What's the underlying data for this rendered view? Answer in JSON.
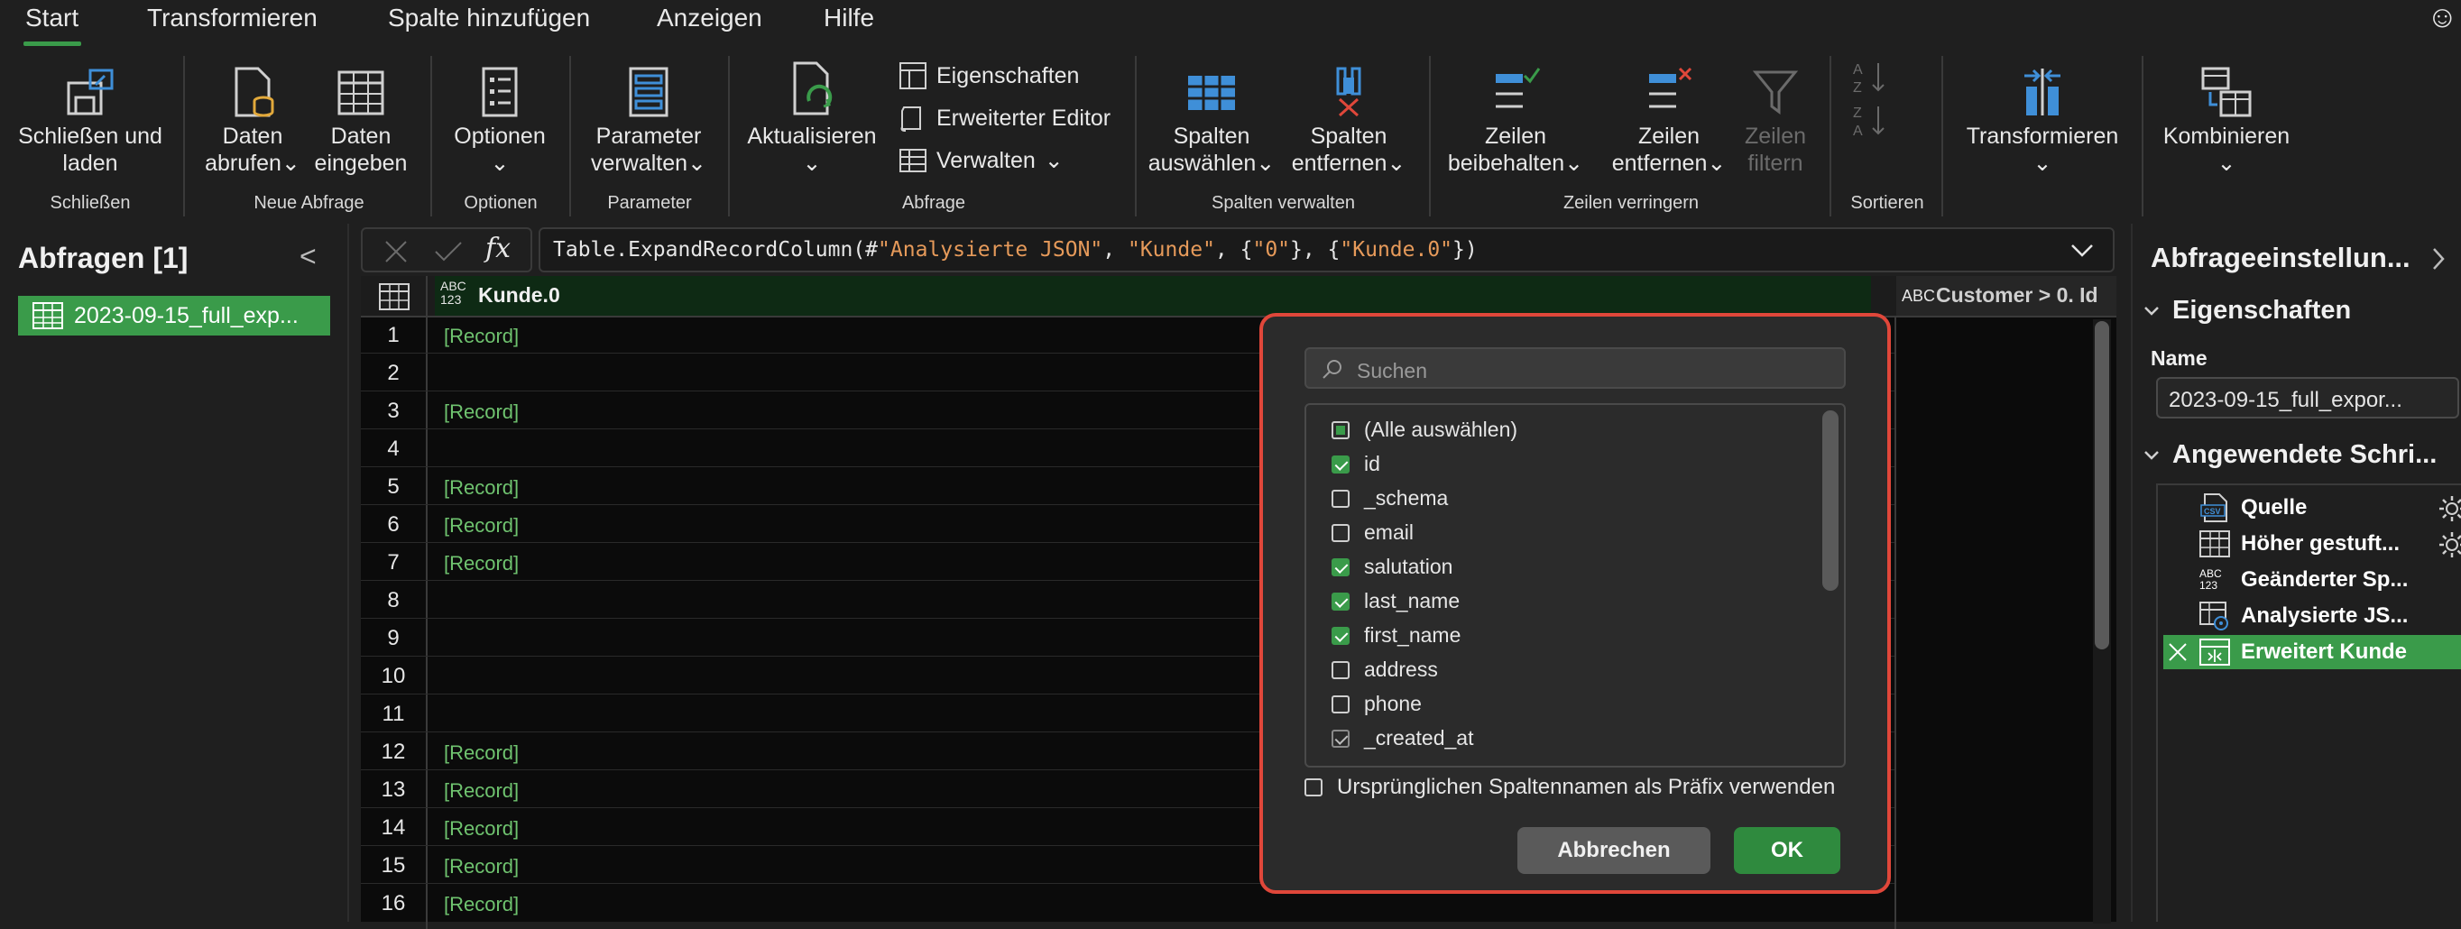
{
  "menu": {
    "tabs": [
      {
        "label": "Start"
      },
      {
        "label": "Transformieren"
      },
      {
        "label": "Spalte hinzufügen"
      },
      {
        "label": "Anzeigen"
      },
      {
        "label": "Hilfe"
      }
    ],
    "smiley": "☺"
  },
  "ribbon": {
    "close_load": {
      "line1": "Schließen und",
      "line2": "laden"
    },
    "get_data": {
      "line1": "Daten",
      "line2": "abrufen"
    },
    "enter_data": {
      "line1": "Daten",
      "line2": "eingeben"
    },
    "options": {
      "line1": "Optionen"
    },
    "manage_params": {
      "line1": "Parameter",
      "line2": "verwalten"
    },
    "refresh": {
      "line1": "Aktualisieren"
    },
    "properties": "Eigenschaften",
    "advanced_editor": "Erweiterter Editor",
    "manage": "Verwalten",
    "choose_columns": {
      "line1": "Spalten",
      "line2": "auswählen"
    },
    "remove_columns": {
      "line1": "Spalten",
      "line2": "entfernen"
    },
    "keep_rows": {
      "line1": "Zeilen",
      "line2": "beibehalten"
    },
    "remove_rows": {
      "line1": "Zeilen",
      "line2": "entfernen"
    },
    "filter_rows": {
      "line1": "Zeilen",
      "line2": "filtern"
    },
    "transform": {
      "line1": "Transformieren"
    },
    "combine": {
      "line1": "Kombinieren"
    },
    "groups": {
      "close": "Schließen",
      "new_query": "Neue Abfrage",
      "options": "Optionen",
      "parameters": "Parameter",
      "query": "Abfrage",
      "manage_columns": "Spalten verwalten",
      "reduce_rows": "Zeilen verringern",
      "sort": "Sortieren"
    },
    "chevron": "⌄"
  },
  "left_panel": {
    "title": "Abfragen [1]",
    "collapse": "<",
    "query_item": "2023-09-15_full_exp..."
  },
  "formula_bar": {
    "fx": "fx",
    "formula_parts": {
      "p1": "Table.ExpandRecordColumn(#",
      "s1": "\"Analysierte JSON\"",
      "p2": ", ",
      "s2": "\"Kunde\"",
      "p3": ", {",
      "s3": "\"0\"",
      "p4": "}, {",
      "s4": "\"Kunde.0\"",
      "p5": "})"
    }
  },
  "grid": {
    "type_badge_top": "ABC",
    "type_badge_bottom": "123",
    "column_header": "Kunde.0",
    "second_header_badge": "ABC",
    "second_column_header": "Customer > 0. Id",
    "rows": [
      {
        "num": "1",
        "value": "[Record]"
      },
      {
        "num": "2",
        "value": ""
      },
      {
        "num": "3",
        "value": "[Record]"
      },
      {
        "num": "4",
        "value": ""
      },
      {
        "num": "5",
        "value": "[Record]"
      },
      {
        "num": "6",
        "value": "[Record]"
      },
      {
        "num": "7",
        "value": "[Record]"
      },
      {
        "num": "8",
        "value": ""
      },
      {
        "num": "9",
        "value": ""
      },
      {
        "num": "10",
        "value": ""
      },
      {
        "num": "11",
        "value": ""
      },
      {
        "num": "12",
        "value": "[Record]"
      },
      {
        "num": "13",
        "value": "[Record]"
      },
      {
        "num": "14",
        "value": "[Record]"
      },
      {
        "num": "15",
        "value": "[Record]"
      },
      {
        "num": "16",
        "value": "[Record]"
      }
    ]
  },
  "dialog": {
    "search_placeholder": "Suchen",
    "options": [
      {
        "label": "(Alle auswählen)",
        "state": "partial"
      },
      {
        "label": "id",
        "state": "checked"
      },
      {
        "label": "_schema",
        "state": "unchecked"
      },
      {
        "label": "email",
        "state": "unchecked"
      },
      {
        "label": "salutation",
        "state": "checked"
      },
      {
        "label": "last_name",
        "state": "checked"
      },
      {
        "label": "first_name",
        "state": "checked"
      },
      {
        "label": "address",
        "state": "unchecked"
      },
      {
        "label": "phone",
        "state": "unchecked"
      },
      {
        "label": "_created_at",
        "state": "gray"
      }
    ],
    "prefix_label": "Ursprünglichen Spaltennamen als Präfix verwenden",
    "cancel": "Abbrechen",
    "ok": "OK"
  },
  "right_panel": {
    "title": "Abfrageeinstellun...",
    "properties_header": "Eigenschaften",
    "name_label": "Name",
    "name_value": "2023-09-15_full_expor...",
    "steps_header": "Angewendete Schri...",
    "steps": [
      {
        "label": "Quelle",
        "icon": "csv-icon"
      },
      {
        "label": "Höher gestuft...",
        "icon": "table-icon"
      },
      {
        "label": "Geänderter Sp...",
        "icon": "abc123-icon"
      },
      {
        "label": "Analysierte JS...",
        "icon": "parse-icon"
      },
      {
        "label": "Erweitert Kunde",
        "icon": "expand-icon"
      }
    ],
    "csv_badge": "CSV"
  },
  "colors": {
    "accent": "#3a9b4a",
    "dialog_border": "#e0473a",
    "record_text": "#6fc36f",
    "icon_blue": "#3f8fd8"
  }
}
